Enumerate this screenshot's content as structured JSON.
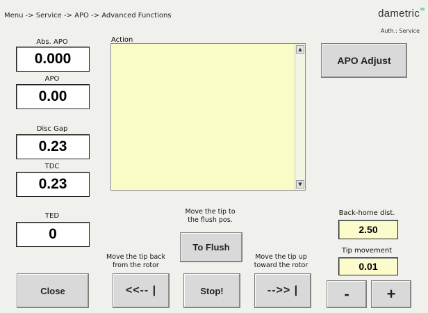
{
  "header": {
    "breadcrumb": "Menu -> Service -> APO -> Advanced Functions",
    "brand": "dametric",
    "auth": "Auth.: Service"
  },
  "readouts": [
    {
      "label": "Abs. APO",
      "value": "0.000"
    },
    {
      "label": "APO",
      "value": "0.00"
    },
    {
      "label": "Disc Gap",
      "value": "0.23"
    },
    {
      "label": "TDC",
      "value": "0.23"
    },
    {
      "label": "TED",
      "value": "0"
    }
  ],
  "action": {
    "label": "Action",
    "text": ""
  },
  "buttons": {
    "apo_adjust": "APO Adjust",
    "close": "Close",
    "back": "<<-- |",
    "to_flush": "To Flush",
    "stop": "Stop!",
    "forward": "-->> |",
    "minus": "-",
    "plus": "+"
  },
  "hints": {
    "flush_line1": "Move the tip to",
    "flush_line2": "the flush pos.",
    "back_line1": "Move the tip back",
    "back_line2": "from the rotor",
    "up_line1": "Move the tip up",
    "up_line2": "toward the rotor"
  },
  "settings": {
    "back_home_label": "Back-home dist.",
    "back_home_value": "2.50",
    "tip_movement_label": "Tip movement",
    "tip_movement_value": "0.01"
  },
  "icons": {
    "scroll_up": "▲",
    "scroll_down": "▼"
  },
  "colors": {
    "background": "#f0f0ec",
    "action_area": "#fafcc8",
    "brand_accent": "#7fd3b8"
  }
}
